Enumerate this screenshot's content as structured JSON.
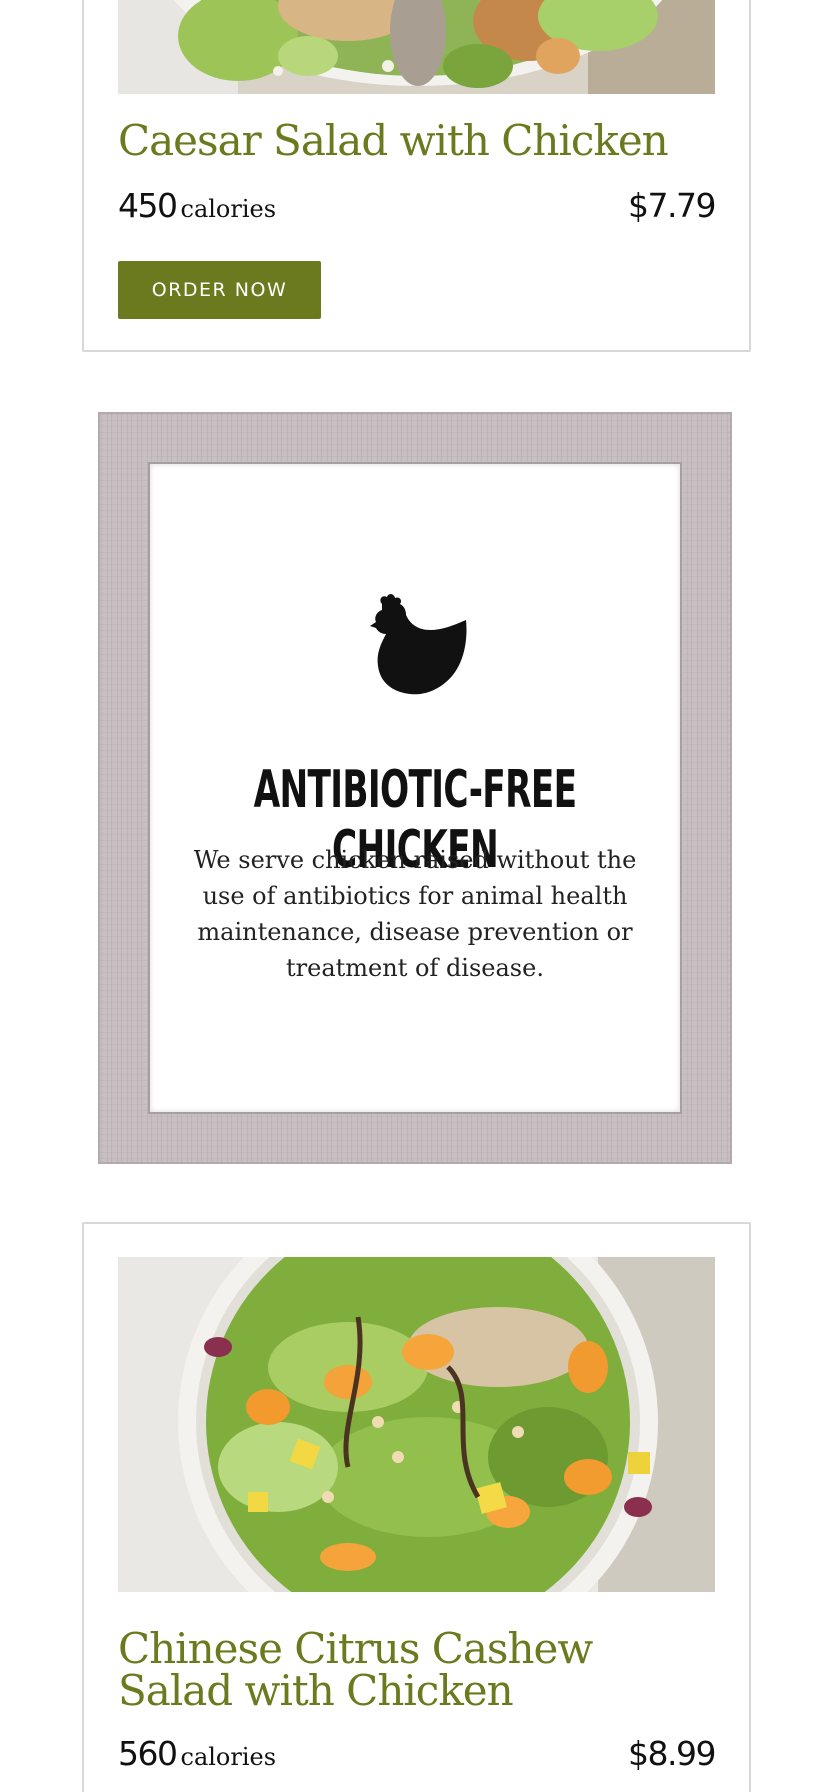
{
  "items": [
    {
      "title": "Caesar Salad with Chicken",
      "calories": "450",
      "calories_label": "calories",
      "price": "$7.79",
      "button_label": "ORDER NOW",
      "image": "caesar-salad-bowl"
    },
    {
      "title": "Chinese Citrus Cashew Salad with Chicken",
      "calories": "560",
      "calories_label": "calories",
      "price": "$8.99",
      "image": "citrus-cashew-salad-bowl"
    }
  ],
  "feature": {
    "icon": "chicken-icon",
    "title": "ANTIBIOTIC-FREE CHICKEN",
    "description": "We serve chicken raised without the use of antibiotics for animal health maintenance, disease prevention or treatment of disease."
  },
  "colors": {
    "brand_green": "#6b7a1e",
    "text": "#111111",
    "border": "#d8d8d8",
    "frame": "#c8bfc3"
  }
}
